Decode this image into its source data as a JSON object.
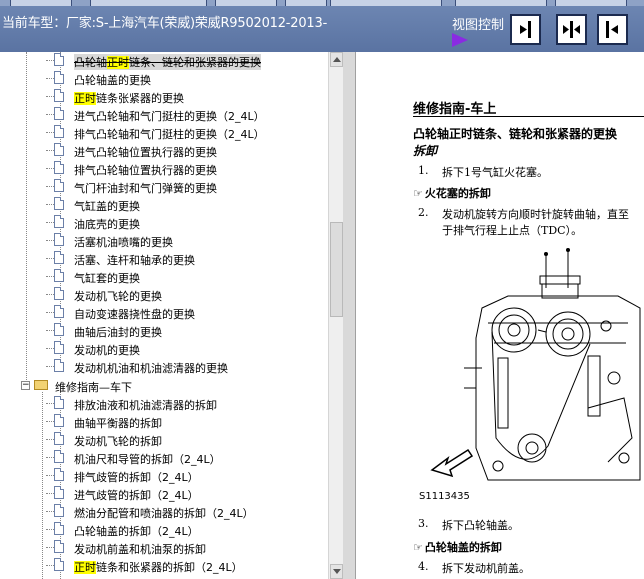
{
  "header": {
    "vehicle": "当前车型：厂家:S-上海汽车(荣威)荣威R9502012-2013-",
    "view_control": "视图控制"
  },
  "tree": {
    "items": [
      {
        "pre": "凸轮轴",
        "hl": "正时",
        "post": "链条、链轮和张紧器的更换",
        "selected": true
      },
      {
        "pre": "凸轮轴盖的更换",
        "hl": "",
        "post": ""
      },
      {
        "pre": "",
        "hl": "正时",
        "post": "链条张紧器的更换"
      },
      {
        "pre": "进气凸轮轴和气门挺柱的更换（2_4L）",
        "hl": "",
        "post": ""
      },
      {
        "pre": "排气凸轮轴和气门挺柱的更换（2_4L）",
        "hl": "",
        "post": ""
      },
      {
        "pre": "进气凸轮轴位置执行器的更换",
        "hl": "",
        "post": ""
      },
      {
        "pre": "排气凸轮轴位置执行器的更换",
        "hl": "",
        "post": ""
      },
      {
        "pre": "气门杆油封和气门弹簧的更换",
        "hl": "",
        "post": ""
      },
      {
        "pre": "气缸盖的更换",
        "hl": "",
        "post": ""
      },
      {
        "pre": "油底壳的更换",
        "hl": "",
        "post": ""
      },
      {
        "pre": "活塞机油喷嘴的更换",
        "hl": "",
        "post": ""
      },
      {
        "pre": "活塞、连杆和轴承的更换",
        "hl": "",
        "post": ""
      },
      {
        "pre": "气缸套的更换",
        "hl": "",
        "post": ""
      },
      {
        "pre": "发动机飞轮的更换",
        "hl": "",
        "post": ""
      },
      {
        "pre": "自动变速器挠性盘的更换",
        "hl": "",
        "post": ""
      },
      {
        "pre": "曲轴后油封的更换",
        "hl": "",
        "post": ""
      },
      {
        "pre": "发动机的更换",
        "hl": "",
        "post": ""
      },
      {
        "pre": "发动机机油和机油滤清器的更换",
        "hl": "",
        "post": ""
      }
    ],
    "folder": {
      "label": "维修指南—车下",
      "expander": "−"
    },
    "sub_items": [
      {
        "pre": "排放油液和机油滤清器的拆卸",
        "hl": "",
        "post": ""
      },
      {
        "pre": "曲轴平衡器的拆卸",
        "hl": "",
        "post": ""
      },
      {
        "pre": "发动机飞轮的拆卸",
        "hl": "",
        "post": ""
      },
      {
        "pre": "机油尺和导管的拆卸（2_4L）",
        "hl": "",
        "post": ""
      },
      {
        "pre": "排气歧管的拆卸（2_4L）",
        "hl": "",
        "post": ""
      },
      {
        "pre": "进气歧管的拆卸（2_4L）",
        "hl": "",
        "post": ""
      },
      {
        "pre": "燃油分配管和喷油器的拆卸（2_4L）",
        "hl": "",
        "post": ""
      },
      {
        "pre": "凸轮轴盖的拆卸（2_4L）",
        "hl": "",
        "post": ""
      },
      {
        "pre": "发动机前盖和机油泵的拆卸",
        "hl": "",
        "post": ""
      },
      {
        "pre": "",
        "hl": "正时",
        "post": "链条和张紧器的拆卸（2_4L）"
      }
    ]
  },
  "document": {
    "section": "维修指南-车上",
    "title": "凸轮轴正时链条、链轮和张紧器的更换",
    "subtitle": "拆卸",
    "step1_num": "1.",
    "step1": "拆下1号气缸火花塞。",
    "ref1_hand": "☞",
    "ref1": "火花塞的拆卸",
    "step2_num": "2.",
    "step2_a": "发动机旋转方向顺时针旋转曲轴，直至",
    "step2_b": "于排气行程上止点（TDC）。",
    "figure_caption": "S1113435",
    "step3_num": "3.",
    "step3": "拆下凸轮轴盖。",
    "ref2_hand": "☞",
    "ref2": "凸轮轴盖的拆卸",
    "step4_num": "4.",
    "step4": "拆下发动机前盖。"
  },
  "icons": {
    "view_buttons": [
      "single-pane-right-icon",
      "dual-pane-icon",
      "single-pane-left-icon"
    ],
    "tree_doc": "document-icon",
    "tree_folder": "folder-icon"
  },
  "colors": {
    "header_bg": "#5f79a8",
    "highlight": "#ffff00",
    "view_arrow": "#8a2be2"
  }
}
